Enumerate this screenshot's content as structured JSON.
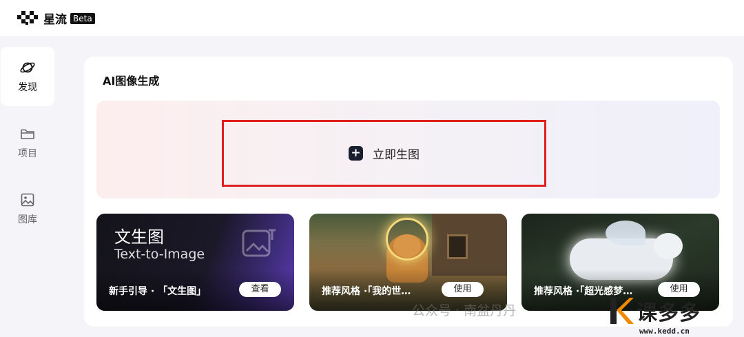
{
  "header": {
    "brand": "星流",
    "badge": "Beta"
  },
  "sidebar": {
    "items": [
      {
        "label": "发现",
        "icon": "planet-icon",
        "active": true
      },
      {
        "label": "项目",
        "icon": "folder-icon",
        "active": false
      },
      {
        "label": "图库",
        "icon": "image-icon",
        "active": false
      }
    ]
  },
  "main": {
    "title": "AI图像生成",
    "generate_label": "立即生图",
    "cards": [
      {
        "title": "文生图",
        "subtitle": "Text-to-Image",
        "caption": "新手引导 · 「文生图」",
        "button": "查看"
      },
      {
        "caption": "推荐风格 ·「我的世…",
        "button": "使用"
      },
      {
        "caption": "推荐风格 ·「超光感梦…",
        "button": "使用"
      }
    ]
  },
  "watermark": {
    "text": "公众号 · 南盆丹丹"
  },
  "corner_logo": {
    "text": "课多多",
    "url": "www.kedd.cn"
  },
  "colors": {
    "accent_dark": "#1b1e2d",
    "highlight_border": "#e02020"
  }
}
